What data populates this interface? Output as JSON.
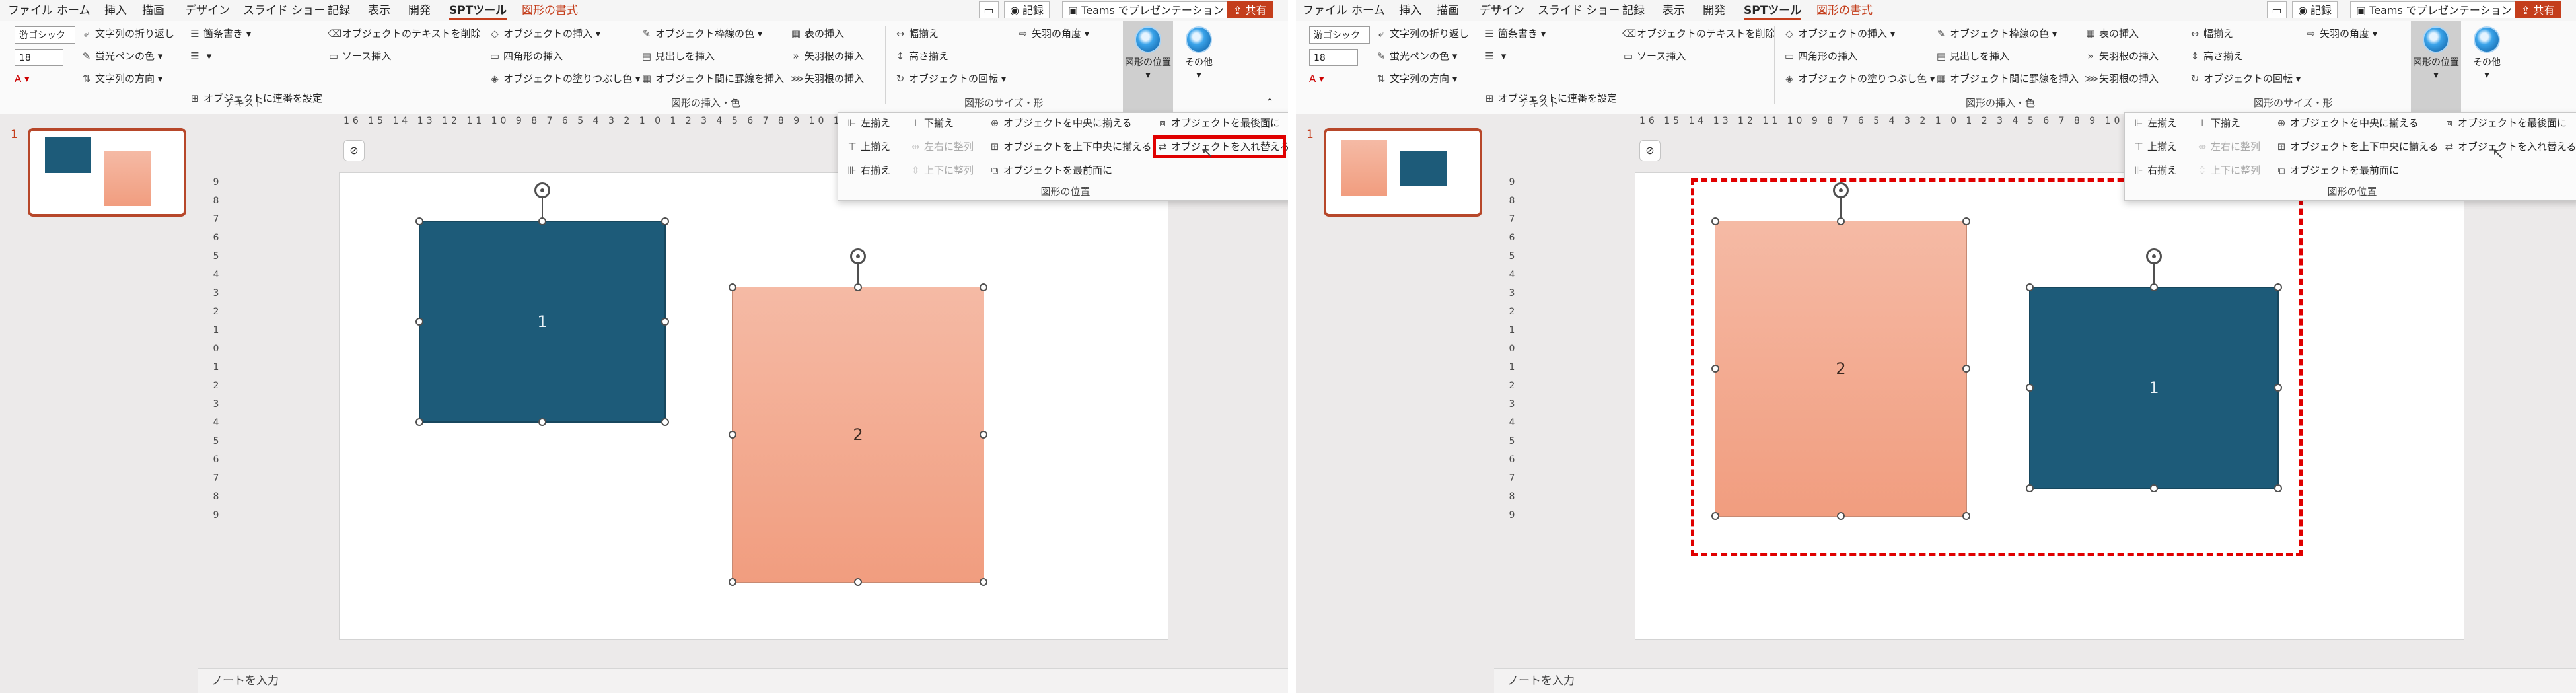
{
  "menu_tabs": [
    "ファイル",
    "ホーム",
    "挿入",
    "描画",
    "デザイン",
    "スライド ショー",
    "記録",
    "表示",
    "開発",
    "SPTツール",
    "図形の書式"
  ],
  "title_right": {
    "record": "記録",
    "teams": "Teams でプレゼンテーション",
    "share": "共有"
  },
  "font_combo": {
    "font": "游ゴシック",
    "size": "18"
  },
  "ribbon": {
    "text_col1": [
      "文字列の折り返し",
      "蛍光ペンの色",
      "文字列の方向"
    ],
    "text_col2": [
      "箇条書き",
      ""
    ],
    "text_extra": [
      "オブジェクトに連番を設定",
      "オブジェクトのテキストを削除",
      "ソース挿入"
    ],
    "insert_col1": [
      "オブジェクトの挿入",
      "四角形の挿入",
      "オブジェクトの塗りつぶし色"
    ],
    "insert_col2": [
      "オブジェクト枠線の色",
      "見出しを挿入",
      "オブジェクト間に罫線を挿入"
    ],
    "insert_col3": [
      "表の挿入",
      "矢羽根の挿入",
      "矢羽根の挿入"
    ],
    "size_col1": [
      "幅揃え",
      "高さ揃え",
      "オブジェクトの回転"
    ],
    "size_col2": [
      "矢羽の角度"
    ],
    "big_position": "図形の位置",
    "big_other": "その他",
    "groups": {
      "text": "テキスト",
      "insert": "図形の挿入・色",
      "size": "図形のサイズ・形"
    }
  },
  "flyout": {
    "col1": [
      "左揃え",
      "上揃え",
      "右揃え"
    ],
    "col2": [
      "下揃え",
      "左右に整列",
      "上下に整列"
    ],
    "col3": [
      "オブジェクトを中央に揃える",
      "オブジェクトを上下中央に揃える",
      "オブジェクトを最前面に"
    ],
    "col4": [
      "オブジェクトを最後面に",
      "オブジェクトを入れ替える"
    ],
    "title": "図形の位置"
  },
  "slide_number": "1",
  "ruler_h": "16 15 14 13 12 11 10 9 8 7 6 5 4 3 2 1 0 1 2 3 4 5 6 7 8 9 10 11 12 13 14 15 16",
  "ruler_v": "9 8 7 6 5 4 3 2 1 0 1 2 3 4 5 6 7 8 9",
  "shape_labels": {
    "blue": "1",
    "salmon": "2"
  },
  "notes_placeholder": "ノートを入力",
  "colors": {
    "blue_shape": "#1d5b79",
    "salmon_shape": "#f4a88c",
    "highlight": "#e00000",
    "accent": "#c43e1c"
  }
}
